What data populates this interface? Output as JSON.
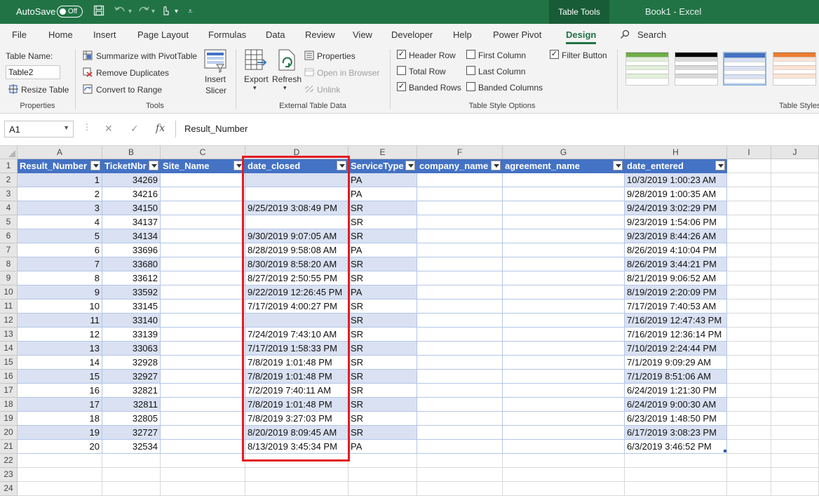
{
  "titlebar": {
    "autosave_label": "AutoSave",
    "autosave_state": "Off",
    "context_tab": "Table Tools",
    "doc_title": "Book1  -  Excel"
  },
  "tabs": [
    "File",
    "Home",
    "Insert",
    "Page Layout",
    "Formulas",
    "Data",
    "Review",
    "View",
    "Developer",
    "Help",
    "Power Pivot",
    "Design"
  ],
  "active_tab": "Design",
  "search_label": "Search",
  "ribbon": {
    "properties": {
      "table_name_label": "Table Name:",
      "table_name_value": "Table2",
      "resize_label": "Resize Table",
      "group_label": "Properties"
    },
    "tools": {
      "summarize": "Summarize with PivotTable",
      "remove_dup": "Remove Duplicates",
      "convert": "Convert to Range",
      "insert_slicer_1": "Insert",
      "insert_slicer_2": "Slicer",
      "group_label": "Tools"
    },
    "external": {
      "export": "Export",
      "refresh": "Refresh",
      "properties": "Properties",
      "open_browser": "Open in Browser",
      "unlink": "Unlink",
      "group_label": "External Table Data"
    },
    "style_options": {
      "header_row": "Header Row",
      "total_row": "Total Row",
      "banded_rows": "Banded Rows",
      "first_column": "First Column",
      "last_column": "Last Column",
      "banded_columns": "Banded Columns",
      "filter_button": "Filter Button",
      "header_row_checked": true,
      "total_row_checked": false,
      "banded_rows_checked": true,
      "first_column_checked": false,
      "last_column_checked": false,
      "banded_columns_checked": false,
      "filter_button_checked": true,
      "group_label": "Table Style Options"
    },
    "styles": {
      "group_label": "Table Styles",
      "swatch_colors": [
        "#70ad47",
        "#000000",
        "#4472c4",
        "#ed7d31"
      ]
    }
  },
  "formula_bar": {
    "namebox": "A1",
    "cancel_icon": "✕",
    "enter_icon": "✓",
    "fx": "fx",
    "formula": "Result_Number"
  },
  "grid": {
    "col_letters": [
      "A",
      "B",
      "C",
      "D",
      "E",
      "F",
      "G",
      "H",
      "I",
      "J"
    ],
    "headers": [
      "Result_Number",
      "TicketNbr",
      "Site_Name",
      "date_closed",
      "ServiceType",
      "company_name",
      "agreement_name",
      "date_entered"
    ],
    "rows": [
      [
        "1",
        "34269",
        "",
        "",
        "PA",
        "",
        "",
        "10/3/2019 1:00:23 AM"
      ],
      [
        "2",
        "34216",
        "",
        "",
        "PA",
        "",
        "",
        "9/28/2019 1:00:35 AM"
      ],
      [
        "3",
        "34150",
        "",
        "9/25/2019 3:08:49 PM",
        "SR",
        "",
        "",
        "9/24/2019 3:02:29 PM"
      ],
      [
        "4",
        "34137",
        "",
        "",
        "SR",
        "",
        "",
        "9/23/2019 1:54:06 PM"
      ],
      [
        "5",
        "34134",
        "",
        "9/30/2019 9:07:05 AM",
        "SR",
        "",
        "",
        "9/23/2019 8:44:26 AM"
      ],
      [
        "6",
        "33696",
        "",
        "8/28/2019 9:58:08 AM",
        "PA",
        "",
        "",
        "8/26/2019 4:10:04 PM"
      ],
      [
        "7",
        "33680",
        "",
        "8/30/2019 8:58:20 AM",
        "SR",
        "",
        "",
        "8/26/2019 3:44:21 PM"
      ],
      [
        "8",
        "33612",
        "",
        "8/27/2019 2:50:55 PM",
        "SR",
        "",
        "",
        "8/21/2019 9:06:52 AM"
      ],
      [
        "9",
        "33592",
        "",
        "9/22/2019 12:26:45 PM",
        "PA",
        "",
        "",
        "8/19/2019 2:20:09 PM"
      ],
      [
        "10",
        "33145",
        "",
        "7/17/2019 4:00:27 PM",
        "SR",
        "",
        "",
        "7/17/2019 7:40:53 AM"
      ],
      [
        "11",
        "33140",
        "",
        "",
        "SR",
        "",
        "",
        "7/16/2019 12:47:43 PM"
      ],
      [
        "12",
        "33139",
        "",
        "7/24/2019 7:43:10 AM",
        "SR",
        "",
        "",
        "7/16/2019 12:36:14 PM"
      ],
      [
        "13",
        "33063",
        "",
        "7/17/2019 1:58:33 PM",
        "SR",
        "",
        "",
        "7/10/2019 2:24:44 PM"
      ],
      [
        "14",
        "32928",
        "",
        "7/8/2019 1:01:48 PM",
        "SR",
        "",
        "",
        "7/1/2019 9:09:29 AM"
      ],
      [
        "15",
        "32927",
        "",
        "7/8/2019 1:01:48 PM",
        "SR",
        "",
        "",
        "7/1/2019 8:51:06 AM"
      ],
      [
        "16",
        "32821",
        "",
        "7/2/2019 7:40:11 AM",
        "SR",
        "",
        "",
        "6/24/2019 1:21:30 PM"
      ],
      [
        "17",
        "32811",
        "",
        "7/8/2019 1:01:48 PM",
        "SR",
        "",
        "",
        "6/24/2019 9:00:30 AM"
      ],
      [
        "18",
        "32805",
        "",
        "7/8/2019 3:27:03 PM",
        "SR",
        "",
        "",
        "6/23/2019 1:48:50 PM"
      ],
      [
        "19",
        "32727",
        "",
        "8/20/2019 8:09:45 AM",
        "SR",
        "",
        "",
        "6/17/2019 3:08:23 PM"
      ],
      [
        "20",
        "32534",
        "",
        "8/13/2019 3:45:34 PM",
        "PA",
        "",
        "",
        "6/3/2019 3:46:52 PM"
      ]
    ],
    "row_numbers": [
      "1",
      "2",
      "3",
      "4",
      "5",
      "6",
      "7",
      "8",
      "9",
      "10",
      "11",
      "12",
      "13",
      "14",
      "15",
      "16",
      "17",
      "18",
      "19",
      "20",
      "21",
      "22",
      "23",
      "24"
    ]
  },
  "highlight_color": "#e31b23",
  "table_header_color": "#4472c4",
  "table_band_color": "#d9e1f2"
}
